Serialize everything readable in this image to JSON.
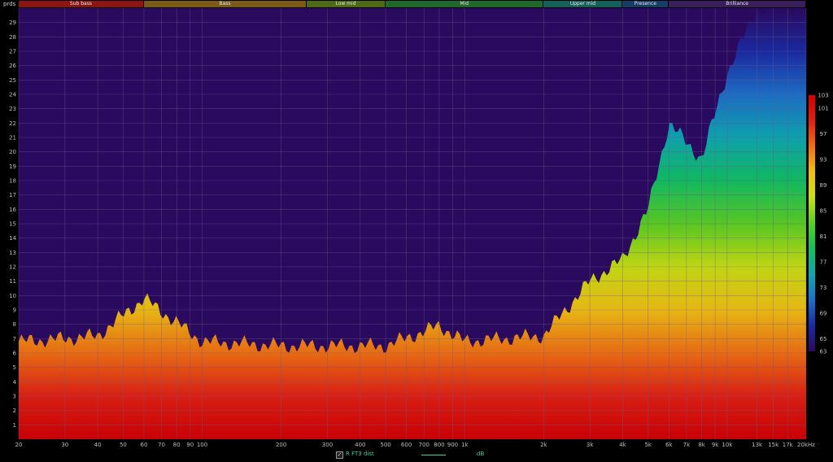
{
  "bands": [
    {
      "name": "Sub bass",
      "from": 20,
      "to": 60,
      "color": "#8e1414"
    },
    {
      "name": "Bass",
      "from": 60,
      "to": 250,
      "color": "#7a5a14"
    },
    {
      "name": "Low mid",
      "from": 250,
      "to": 500,
      "color": "#4e6a14"
    },
    {
      "name": "Mid",
      "from": 500,
      "to": 2000,
      "color": "#1f6a2a"
    },
    {
      "name": "Upper mid",
      "from": 2000,
      "to": 4000,
      "color": "#14605a"
    },
    {
      "name": "Presence",
      "from": 4000,
      "to": 6000,
      "color": "#163c68"
    },
    {
      "name": "Brilliance",
      "from": 6000,
      "to": 20000,
      "color": "#3a1f5c"
    }
  ],
  "legend": {
    "series": "R FT3 dist",
    "unit": "dB",
    "checked": true
  },
  "chart_data": {
    "type": "heatmap",
    "title": "",
    "xlabel": "",
    "ylabel": "prds",
    "x_scale": "log",
    "xlim": [
      20,
      20000
    ],
    "ylim": [
      0,
      30
    ],
    "x_ticks": [
      {
        "v": 20,
        "label": "20"
      },
      {
        "v": 30,
        "label": "30"
      },
      {
        "v": 40,
        "label": "40"
      },
      {
        "v": 50,
        "label": "50"
      },
      {
        "v": 60,
        "label": "60"
      },
      {
        "v": 70,
        "label": "70"
      },
      {
        "v": 80,
        "label": "80"
      },
      {
        "v": 90,
        "label": "90"
      },
      {
        "v": 100,
        "label": "100"
      },
      {
        "v": 200,
        "label": "200"
      },
      {
        "v": 300,
        "label": "300"
      },
      {
        "v": 400,
        "label": "400"
      },
      {
        "v": 500,
        "label": "500"
      },
      {
        "v": 600,
        "label": "600"
      },
      {
        "v": 700,
        "label": "700"
      },
      {
        "v": 800,
        "label": "800"
      },
      {
        "v": 900,
        "label": "900"
      },
      {
        "v": 1000,
        "label": "1k"
      },
      {
        "v": 2000,
        "label": "2k"
      },
      {
        "v": 3000,
        "label": "3k"
      },
      {
        "v": 4000,
        "label": "4k"
      },
      {
        "v": 5000,
        "label": "5k"
      },
      {
        "v": 6000,
        "label": "6k"
      },
      {
        "v": 7000,
        "label": "7k"
      },
      {
        "v": 8000,
        "label": "8k"
      },
      {
        "v": 9000,
        "label": "9k"
      },
      {
        "v": 10000,
        "label": "10k"
      },
      {
        "v": 13000,
        "label": "13k"
      },
      {
        "v": 15000,
        "label": "15k"
      },
      {
        "v": 17000,
        "label": "17k"
      },
      {
        "v": 20000,
        "label": "20kHz"
      }
    ],
    "y_ticks": [
      1,
      2,
      3,
      4,
      5,
      6,
      7,
      8,
      9,
      10,
      11,
      12,
      13,
      14,
      15,
      16,
      17,
      18,
      19,
      20,
      21,
      22,
      23,
      24,
      25,
      26,
      27,
      28,
      29
    ],
    "colorbar": {
      "unit": "dB",
      "range": [
        63,
        103
      ],
      "ticks": [
        63,
        65,
        69,
        73,
        77,
        81,
        85,
        89,
        93,
        97,
        101,
        103
      ],
      "colors": [
        "#2a0a5e",
        "#1a2aa0",
        "#1d70c8",
        "#0da8b0",
        "#10c060",
        "#5ad020",
        "#c8e010",
        "#f0c010",
        "#f07010",
        "#e02010",
        "#d00000"
      ]
    },
    "background_color": "#2a0a5e",
    "decay_periods_by_freq": [
      {
        "f": 20,
        "p": 6.8
      },
      {
        "f": 30,
        "p": 7.0
      },
      {
        "f": 40,
        "p": 7.2
      },
      {
        "f": 60,
        "p": 9.8
      },
      {
        "f": 100,
        "p": 6.8
      },
      {
        "f": 200,
        "p": 6.5
      },
      {
        "f": 500,
        "p": 6.5
      },
      {
        "f": 800,
        "p": 7.9
      },
      {
        "f": 1000,
        "p": 6.8
      },
      {
        "f": 2000,
        "p": 7.2
      },
      {
        "f": 3000,
        "p": 11.0
      },
      {
        "f": 4000,
        "p": 12.5
      },
      {
        "f": 5000,
        "p": 16.0
      },
      {
        "f": 6000,
        "p": 22.0
      },
      {
        "f": 8000,
        "p": 19.5
      },
      {
        "f": 10000,
        "p": 25.5
      },
      {
        "f": 13000,
        "p": 30
      },
      {
        "f": 20000,
        "p": 30
      }
    ]
  }
}
